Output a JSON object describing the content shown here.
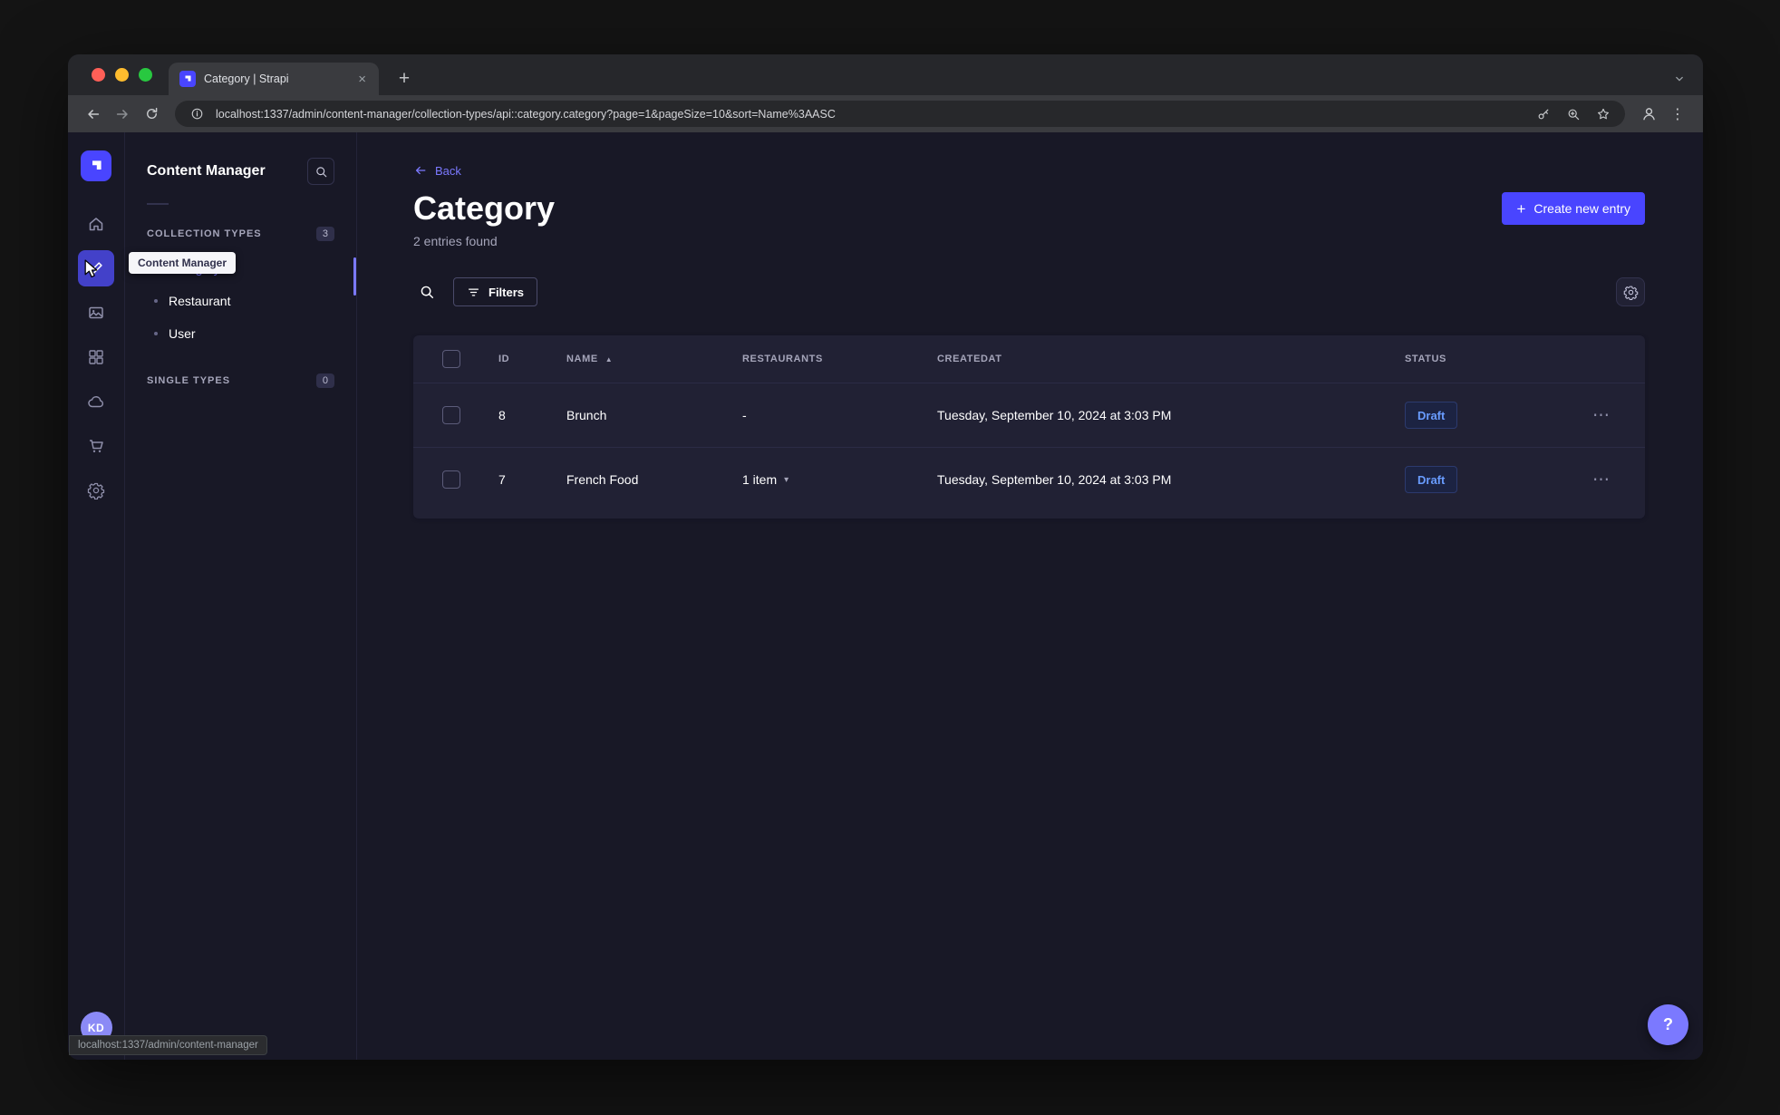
{
  "colors": {
    "accent": "#4945ff",
    "link": "#7b79ff",
    "draft_text": "#699cff",
    "surface": "#212134",
    "background": "#181826"
  },
  "icons": {
    "close": "×",
    "plus": "+",
    "kebab": "⋮",
    "ellipsis": "⋯",
    "sort_asc": "▲",
    "caret_down": "▾",
    "question": "?"
  },
  "browser": {
    "tab_title": "Category | Strapi",
    "url": "localhost:1337/admin/content-manager/collection-types/api::category.category?page=1&pageSize=10&sort=Name%3AASC",
    "status_text": "localhost:1337/admin/content-manager"
  },
  "rail": {
    "user_initials": "KD"
  },
  "tooltip": {
    "label": "Content Manager"
  },
  "subnav": {
    "title": "Content Manager",
    "collection_types": {
      "label": "COLLECTION TYPES",
      "count": "3",
      "items": [
        {
          "label": "Category",
          "active": true
        },
        {
          "label": "Restaurant",
          "active": false
        },
        {
          "label": "User",
          "active": false
        }
      ]
    },
    "single_types": {
      "label": "SINGLE TYPES",
      "count": "0"
    }
  },
  "page": {
    "back_label": "Back",
    "title": "Category",
    "subtitle": "2 entries found",
    "create_button": "Create new entry",
    "filters_button": "Filters"
  },
  "table": {
    "headers": {
      "id": "ID",
      "name": "NAME",
      "restaurants": "RESTAURANTS",
      "createdat": "CREATEDAT",
      "status": "STATUS"
    },
    "rows": [
      {
        "id": "8",
        "name": "Brunch",
        "restaurants": "-",
        "createdat": "Tuesday, September 10, 2024 at 3:03 PM",
        "status": "Draft"
      },
      {
        "id": "7",
        "name": "French Food",
        "restaurants": "1 item",
        "createdat": "Tuesday, September 10, 2024 at 3:03 PM",
        "status": "Draft"
      }
    ]
  }
}
